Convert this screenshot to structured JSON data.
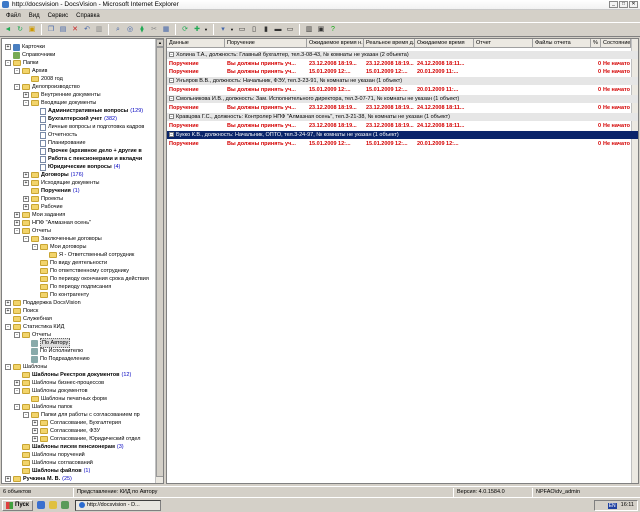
{
  "window": {
    "title": "http://docsvision - DocsVision - Microsoft Internet Explorer",
    "buttons": [
      "_",
      "□",
      "✕"
    ]
  },
  "menu": [
    "Файл",
    "Вид",
    "Сервис",
    "Справка"
  ],
  "toolbar_icons": [
    "back-icon",
    "refresh-icon",
    "new-folder-icon",
    "copy-icon",
    "paste-icon",
    "delete-icon",
    "undo-icon",
    "properties-icon",
    "search-icon",
    "find-icon",
    "filter-icon",
    "cut-icon",
    "print-icon",
    "sync-icon",
    "new-card-icon",
    "view-icon",
    "layout1-icon",
    "layout2-icon",
    "layout3-icon",
    "layout4-icon",
    "layout5-icon",
    "columns-icon",
    "preview-icon",
    "help-icon"
  ],
  "tree": [
    {
      "label": "Карточки",
      "depth": 0,
      "exp": "+",
      "icon": "card"
    },
    {
      "label": "Справочники",
      "depth": 0,
      "exp": "",
      "icon": "book"
    },
    {
      "label": "Папки",
      "depth": 0,
      "exp": "-",
      "icon": "folder"
    },
    {
      "label": "Архив",
      "depth": 1,
      "exp": "-",
      "icon": "folder"
    },
    {
      "label": "2008 год",
      "depth": 2,
      "exp": "",
      "icon": "folder"
    },
    {
      "label": "Делопроизводство",
      "depth": 1,
      "exp": "-",
      "icon": "folder"
    },
    {
      "label": "Внутренние документы",
      "depth": 2,
      "exp": "+",
      "icon": "folder"
    },
    {
      "label": "Входящие документы",
      "depth": 2,
      "exp": "-",
      "icon": "folder"
    },
    {
      "label": "Административные вопросы",
      "depth": 3,
      "exp": "",
      "icon": "doc",
      "bold": true,
      "count": "(129)"
    },
    {
      "label": "Бухгалтерский учет",
      "depth": 3,
      "exp": "",
      "icon": "doc",
      "bold": true,
      "count": "(382)"
    },
    {
      "label": "Личные вопросы и подготовка кадров",
      "depth": 3,
      "exp": "",
      "icon": "doc"
    },
    {
      "label": "Отчетность",
      "depth": 3,
      "exp": "",
      "icon": "doc"
    },
    {
      "label": "Планирование",
      "depth": 3,
      "exp": "",
      "icon": "doc"
    },
    {
      "label": "Прочее (архивное дело + другие в",
      "depth": 3,
      "exp": "",
      "icon": "doc",
      "bold": true
    },
    {
      "label": "Работа с пенсионерами и вкладчи",
      "depth": 3,
      "exp": "",
      "icon": "doc",
      "bold": true
    },
    {
      "label": "Юридические вопросы",
      "depth": 3,
      "exp": "",
      "icon": "doc",
      "bold": true,
      "count": "(4)"
    },
    {
      "label": "Договоры",
      "depth": 2,
      "exp": "+",
      "icon": "folder",
      "bold": true,
      "count": "(176)"
    },
    {
      "label": "Исходящие документы",
      "depth": 2,
      "exp": "+",
      "icon": "folder"
    },
    {
      "label": "Поручения",
      "depth": 2,
      "exp": "",
      "icon": "folder",
      "bold": true,
      "count": "(1)"
    },
    {
      "label": "Проекты",
      "depth": 2,
      "exp": "+",
      "icon": "folder"
    },
    {
      "label": "Рабочие",
      "depth": 2,
      "exp": "+",
      "icon": "folder"
    },
    {
      "label": "Мои задания",
      "depth": 1,
      "exp": "+",
      "icon": "folder"
    },
    {
      "label": "НПФ \"Алмазная осень\"",
      "depth": 1,
      "exp": "+",
      "icon": "folder"
    },
    {
      "label": "Отчеты",
      "depth": 1,
      "exp": "-",
      "icon": "folder"
    },
    {
      "label": "Заключенные договоры",
      "depth": 2,
      "exp": "-",
      "icon": "folder"
    },
    {
      "label": "Мои договоры",
      "depth": 3,
      "exp": "-",
      "icon": "folder"
    },
    {
      "label": "Я - Ответственный сотрудник",
      "depth": 4,
      "exp": "",
      "icon": "folder"
    },
    {
      "label": "По виду деятельности",
      "depth": 3,
      "exp": "",
      "icon": "folder"
    },
    {
      "label": "По ответственному сотруднику",
      "depth": 3,
      "exp": "",
      "icon": "folder"
    },
    {
      "label": "По периоду окончания срока действия",
      "depth": 3,
      "exp": "",
      "icon": "folder"
    },
    {
      "label": "По периоду подписания",
      "depth": 3,
      "exp": "",
      "icon": "folder"
    },
    {
      "label": "По контрагенту",
      "depth": 3,
      "exp": "",
      "icon": "folder"
    },
    {
      "label": "Поддержка DocsVision",
      "depth": 0,
      "exp": "+",
      "icon": "folder"
    },
    {
      "label": "Поиск",
      "depth": 0,
      "exp": "+",
      "icon": "folder"
    },
    {
      "label": "Служебная",
      "depth": 0,
      "exp": "",
      "icon": "folder"
    },
    {
      "label": "Статистика КИД",
      "depth": 0,
      "exp": "-",
      "icon": "folder"
    },
    {
      "label": "Отчеты",
      "depth": 1,
      "exp": "-",
      "icon": "folder"
    },
    {
      "label": "По Автору",
      "depth": 2,
      "exp": "",
      "icon": "view",
      "selected": true
    },
    {
      "label": "По Исполнителю",
      "depth": 2,
      "exp": "",
      "icon": "view"
    },
    {
      "label": "По Подразделению",
      "depth": 2,
      "exp": "",
      "icon": "view"
    },
    {
      "label": "Шаблоны",
      "depth": 0,
      "exp": "-",
      "icon": "folder"
    },
    {
      "label": "Шаблоны Реестров документов",
      "depth": 1,
      "exp": "",
      "icon": "folder",
      "bold": true,
      "count": "(12)"
    },
    {
      "label": "Шаблоны бизнес-процессов",
      "depth": 1,
      "exp": "+",
      "icon": "folder"
    },
    {
      "label": "Шаблоны документов",
      "depth": 1,
      "exp": "-",
      "icon": "folder"
    },
    {
      "label": "Шаблоны печатных форм",
      "depth": 2,
      "exp": "",
      "icon": "folder"
    },
    {
      "label": "Шаблоны папок",
      "depth": 1,
      "exp": "-",
      "icon": "folder"
    },
    {
      "label": "Папки для работы с согласованием пр",
      "depth": 2,
      "exp": "-",
      "icon": "folder"
    },
    {
      "label": "Согласование, Бухгалтерия",
      "depth": 3,
      "exp": "+",
      "icon": "folder"
    },
    {
      "label": "Согласование, ФЗУ",
      "depth": 3,
      "exp": "+",
      "icon": "folder"
    },
    {
      "label": "Согласование, Юридический отдел",
      "depth": 3,
      "exp": "+",
      "icon": "folder"
    },
    {
      "label": "Шаблоны писем пенсионерам",
      "depth": 1,
      "exp": "",
      "icon": "folder",
      "bold": true,
      "count": "(3)"
    },
    {
      "label": "Шаблоны поручений",
      "depth": 1,
      "exp": "",
      "icon": "folder"
    },
    {
      "label": "Шаблоны согласований",
      "depth": 1,
      "exp": "",
      "icon": "folder"
    },
    {
      "label": "Шаблоны файлов",
      "depth": 1,
      "exp": "",
      "icon": "folder",
      "bold": true,
      "count": "(1)"
    },
    {
      "label": "Ручкина М. В.",
      "depth": 0,
      "exp": "+",
      "icon": "folder",
      "bold": true,
      "count": "(25)"
    }
  ],
  "grid": {
    "columns": [
      "Данные",
      "Поручение",
      "Ожидаемое время н...",
      "Реальное время д...",
      "Ожидаемое время",
      "Отчет",
      "Файлы отчета",
      "%",
      "Состояние"
    ],
    "groups": [
      {
        "header": "Холина Т.А., должность: Главный бухгалтер, тел.3-08-43, № комнаты не указан (2 объекта)",
        "rows": [
          [
            "Поручение",
            "Вы должны принять уч...",
            "23.12.2008 18:19...",
            "23.12.2008 18:19...",
            "24.12.2008 18:11...",
            "",
            "",
            "0",
            "Не начато"
          ],
          [
            "Поручение",
            "Вы должны принять уч...",
            "15.01.2009 12:...",
            "15.01.2009 12:...",
            "20.01.2009 11:...",
            "",
            "",
            "0",
            "Не начато"
          ]
        ]
      },
      {
        "header": "Унъяров В.В., должность: Начальник, ФЭУ, тел.3-23-91, № комнаты не указан (1 объект)",
        "rows": [
          [
            "Поручение",
            "Вы должны принять уч...",
            "15.01.2009 12:...",
            "15.01.2009 12:...",
            "20.01.2009 11:...",
            "",
            "",
            "0",
            "Не начато"
          ]
        ]
      },
      {
        "header": "Смольникова И.В., должность: Зам. Исполнительного директора, тел.3-07-71, № комнаты не указан (1 объект)",
        "rows": [
          [
            "Поручение",
            "Вы должны принять уч...",
            "23.12.2008 18:19...",
            "23.12.2008 18:19...",
            "24.12.2008 18:11...",
            "",
            "",
            "0",
            "Не начато"
          ]
        ]
      },
      {
        "header": "Кравцова Г.С., должность: Контролер НПФ \"Алмазная осень\", тел.3-21-38, № комнаты не указан (1 объект)",
        "rows": [
          [
            "Поручение",
            "Вы должны принять уч...",
            "23.12.2008 18:19...",
            "23.12.2008 18:19...",
            "24.12.2008 18:11...",
            "",
            "",
            "0",
            "Не начато"
          ]
        ]
      },
      {
        "header": "Букко К.В., должность: Начальник, ОПТО, тел.3-24-97, № комнаты не указан (1 объект)",
        "selected": true,
        "rows": [
          [
            "Поручение",
            "Вы должны принять уч...",
            "15.01.2009 12:...",
            "15.01.2009 12:...",
            "20.01.2009 12:...",
            "",
            "",
            "0",
            "Не начато"
          ]
        ]
      }
    ]
  },
  "status": {
    "count": "6 объектов",
    "view": "Представление: КИД по Автору",
    "version": "Версия: 4.0.1584.0",
    "user": "NPFAO\\dv_admin"
  },
  "taskbar": {
    "start": "Пуск",
    "task": "http://docsvision - D...",
    "lang": "EN",
    "clock": "16:11"
  }
}
